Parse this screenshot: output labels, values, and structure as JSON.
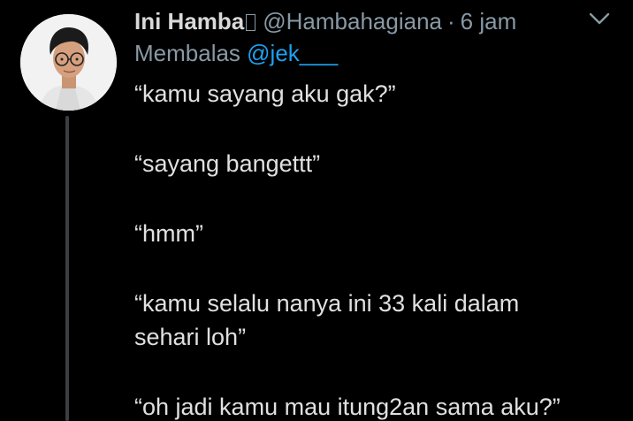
{
  "tweet": {
    "display_name": "Ini Hamba",
    "handle": "@Hambahagiana",
    "separator": "·",
    "time": "6 jam",
    "reply_prefix": "Membalas ",
    "reply_mention": "@jek___",
    "lines": [
      "“kamu sayang aku gak?”",
      "“sayang bangettt”",
      "“hmm”",
      "“kamu selalu nanya ini 33 kali dalam",
      "sehari loh”",
      "“oh jadi kamu mau itung2an sama aku?”"
    ]
  },
  "icons": {
    "avatar": "profile-photo-icon",
    "menu": "chevron-down-icon",
    "name_glyph": "unknown-glyph-icon"
  },
  "colors": {
    "background": "#000000",
    "text": "#d9d9d9",
    "muted": "#8899a6",
    "accent": "#1da1f2",
    "thread": "#3a3f44"
  }
}
